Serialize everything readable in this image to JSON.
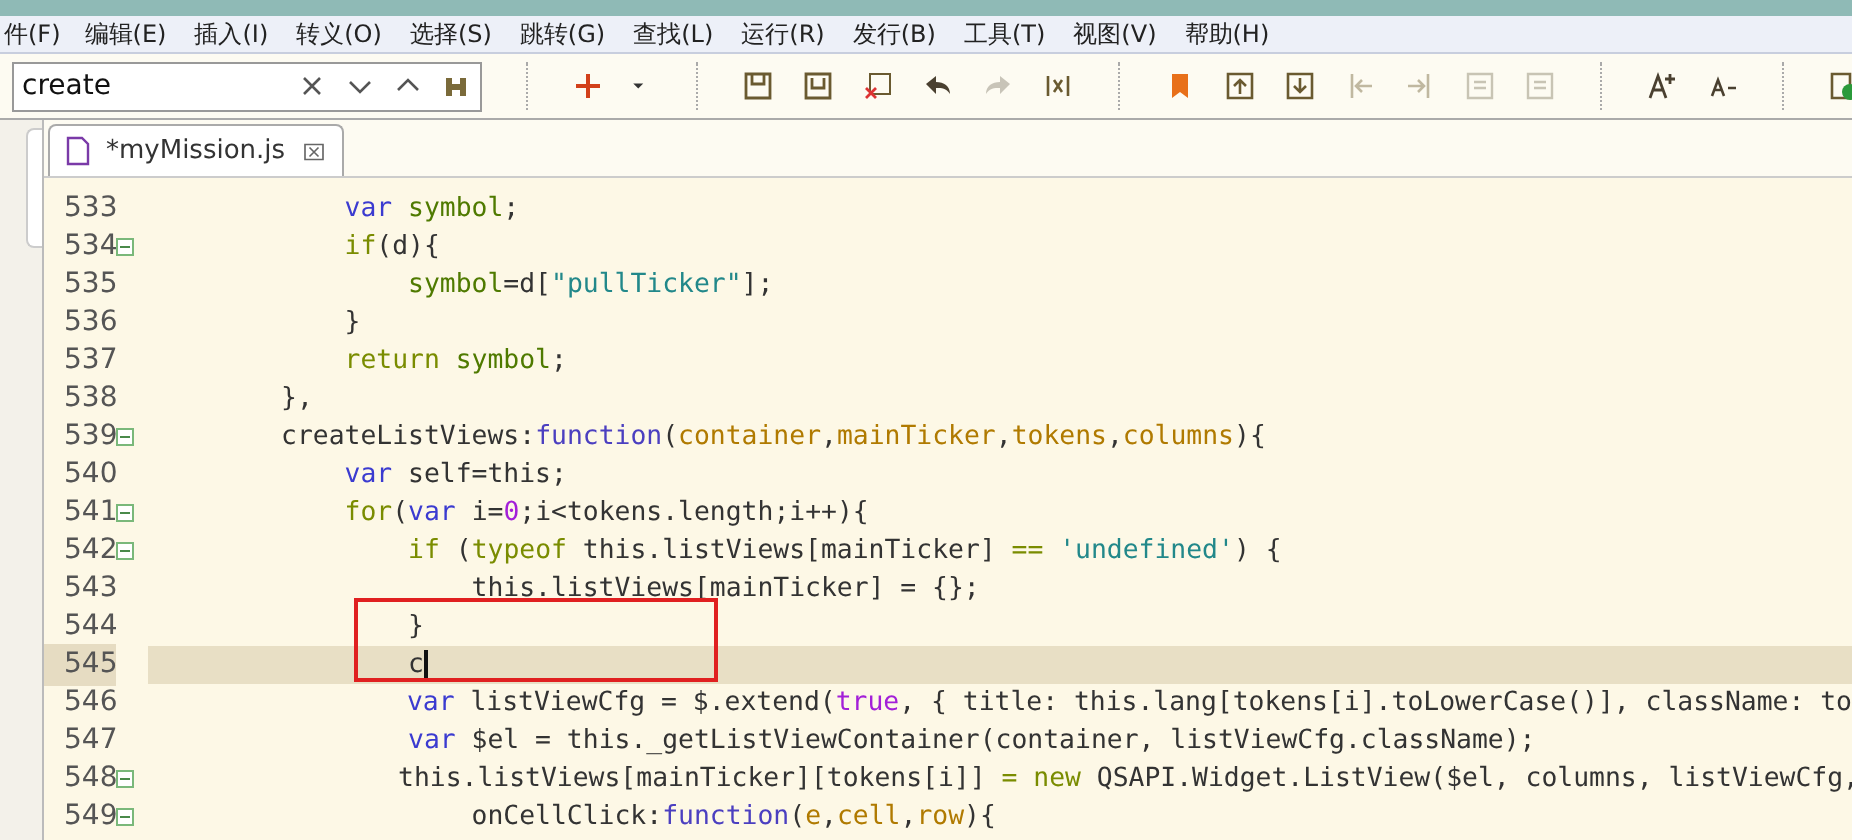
{
  "menu": [
    "件(F)",
    "编辑(E)",
    "插入(I)",
    "转义(O)",
    "选择(S)",
    "跳转(G)",
    "查找(L)",
    "运行(R)",
    "发行(B)",
    "工具(T)",
    "视图(V)",
    "帮助(H)"
  ],
  "search": {
    "value": "create"
  },
  "tabs": [
    {
      "label": "*myMission.js",
      "selected": true
    }
  ],
  "editor": {
    "lines": [
      {
        "number": "533",
        "fold": false,
        "current": false,
        "tokens": [
          {
            "text": "            var",
            "kind": "decl"
          },
          {
            "text": " symbol",
            "kind": "local"
          },
          {
            "text": ";",
            "kind": "text"
          }
        ]
      },
      {
        "number": "534",
        "fold": true,
        "current": false,
        "tokens": [
          {
            "text": "            if",
            "kind": "control"
          },
          {
            "text": "(d){",
            "kind": "text"
          }
        ]
      },
      {
        "number": "535",
        "fold": false,
        "current": false,
        "tokens": [
          {
            "text": "                symbol",
            "kind": "local"
          },
          {
            "text": "=d[",
            "kind": "text"
          },
          {
            "text": "\"pullTicker\"",
            "kind": "string"
          },
          {
            "text": "];",
            "kind": "text"
          }
        ]
      },
      {
        "number": "536",
        "fold": false,
        "current": false,
        "tokens": [
          {
            "text": "            }",
            "kind": "text"
          }
        ]
      },
      {
        "number": "537",
        "fold": false,
        "current": false,
        "tokens": [
          {
            "text": "            return",
            "kind": "control"
          },
          {
            "text": " symbol",
            "kind": "local"
          },
          {
            "text": ";",
            "kind": "text"
          }
        ]
      },
      {
        "number": "538",
        "fold": false,
        "current": false,
        "tokens": [
          {
            "text": "        },",
            "kind": "text"
          }
        ]
      },
      {
        "number": "539",
        "fold": true,
        "current": false,
        "tokens": [
          {
            "text": "        createListViews:",
            "kind": "text"
          },
          {
            "text": "function",
            "kind": "fn"
          },
          {
            "text": "(",
            "kind": "text"
          },
          {
            "text": "container",
            "kind": "param"
          },
          {
            "text": ",",
            "kind": "text"
          },
          {
            "text": "mainTicker",
            "kind": "param"
          },
          {
            "text": ",",
            "kind": "text"
          },
          {
            "text": "tokens",
            "kind": "param"
          },
          {
            "text": ",",
            "kind": "text"
          },
          {
            "text": "columns",
            "kind": "param"
          },
          {
            "text": "){",
            "kind": "text"
          }
        ]
      },
      {
        "number": "540",
        "fold": false,
        "current": false,
        "tokens": [
          {
            "text": "            var",
            "kind": "decl"
          },
          {
            "text": " self=this;",
            "kind": "text"
          }
        ]
      },
      {
        "number": "541",
        "fold": true,
        "current": false,
        "tokens": [
          {
            "text": "            for",
            "kind": "control"
          },
          {
            "text": "(",
            "kind": "text"
          },
          {
            "text": "var",
            "kind": "decl"
          },
          {
            "text": " i=",
            "kind": "text"
          },
          {
            "text": "0",
            "kind": "literal"
          },
          {
            "text": ";i<tokens.length;i++){",
            "kind": "text"
          }
        ]
      },
      {
        "number": "542",
        "fold": true,
        "current": false,
        "tokens": [
          {
            "text": "                if",
            "kind": "control"
          },
          {
            "text": " (",
            "kind": "text"
          },
          {
            "text": "typeof",
            "kind": "control"
          },
          {
            "text": " this.listViews[mainTicker] ",
            "kind": "text"
          },
          {
            "text": "==",
            "kind": "control"
          },
          {
            "text": " 'undefined'",
            "kind": "string"
          },
          {
            "text": ") {",
            "kind": "text"
          }
        ]
      },
      {
        "number": "543",
        "fold": false,
        "current": false,
        "tokens": [
          {
            "text": "                    this.listViews[mainTicker] = {};",
            "kind": "text"
          }
        ]
      },
      {
        "number": "544",
        "fold": false,
        "current": false,
        "tokens": [
          {
            "text": "                }",
            "kind": "text"
          }
        ]
      },
      {
        "number": "545",
        "fold": false,
        "current": true,
        "tokens": [
          {
            "text": "                c",
            "kind": "text"
          }
        ]
      },
      {
        "number": "546",
        "fold": false,
        "current": false,
        "tokens": [
          {
            "text": "                var",
            "kind": "decl"
          },
          {
            "text": " listViewCfg = $.extend(",
            "kind": "text"
          },
          {
            "text": "true",
            "kind": "literal"
          },
          {
            "text": ", { title: this.lang[tokens[i].toLowerCase()], className: to",
            "kind": "text"
          }
        ]
      },
      {
        "number": "547",
        "fold": false,
        "current": false,
        "tokens": [
          {
            "text": "                var",
            "kind": "decl"
          },
          {
            "text": " $el = this._getListViewContainer(container, listViewCfg.className);",
            "kind": "text"
          }
        ]
      },
      {
        "number": "548",
        "fold": true,
        "current": false,
        "tokens": [
          {
            "text": "                this.listViews[mainTicker][tokens[i]] ",
            "kind": "text"
          },
          {
            "text": "= new",
            "kind": "control"
          },
          {
            "text": " QSAPI.Widget.ListView($el, columns, listViewCfg,",
            "kind": "text"
          }
        ]
      },
      {
        "number": "549",
        "fold": true,
        "current": false,
        "tokens": [
          {
            "text": "                    onCellClick:",
            "kind": "text"
          },
          {
            "text": "function",
            "kind": "fn"
          },
          {
            "text": "(",
            "kind": "text"
          },
          {
            "text": "e",
            "kind": "param"
          },
          {
            "text": ",",
            "kind": "text"
          },
          {
            "text": "cell",
            "kind": "param"
          },
          {
            "text": ",",
            "kind": "text"
          },
          {
            "text": "row",
            "kind": "param"
          },
          {
            "text": "){",
            "kind": "text"
          }
        ]
      }
    ]
  }
}
